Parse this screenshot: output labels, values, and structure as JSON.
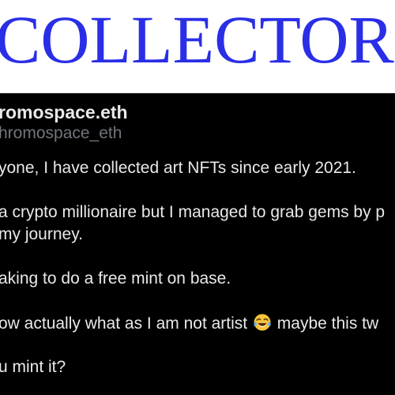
{
  "banner": {
    "title": "COLLECTOR NF",
    "title_color": "#2a2ee6"
  },
  "tweet": {
    "display_name": "romospace.eth",
    "handle": "hromospace_eth",
    "lines": [
      "yone, I have collected art NFTs since early 2021.",
      "a crypto millionaire but I managed to grab gems by p",
      " my journey.",
      "aking to do a free mint on base.",
      "ow actually what as I am not artist ",
      " maybe this tw",
      "u mint it?"
    ],
    "emoji_icon": "face-with-tears-of-joy-icon",
    "text_color": "#e7e9ea",
    "handle_color": "#71767b",
    "background": "#000000"
  }
}
